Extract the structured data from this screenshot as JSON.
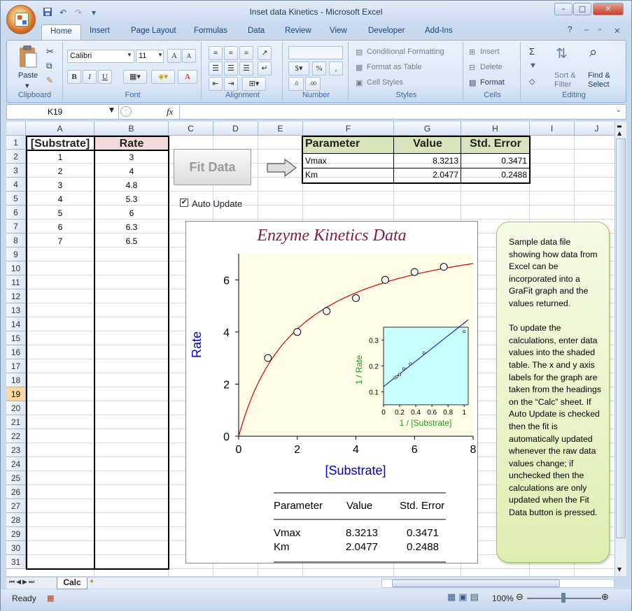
{
  "window": {
    "title": "Inset data Kinetics - Microsoft Excel",
    "controls": [
      "–",
      "□",
      "✕"
    ]
  },
  "qat": {
    "icons": [
      "save-icon",
      "undo-icon",
      "redo-icon",
      "customize-icon"
    ]
  },
  "tabs": [
    "Home",
    "Insert",
    "Page Layout",
    "Formulas",
    "Data",
    "Review",
    "View",
    "Developer",
    "Add-Ins"
  ],
  "ribbon": {
    "clipboard": {
      "label": "Clipboard",
      "paste": "Paste"
    },
    "font": {
      "label": "Font",
      "name": "Calibri",
      "size": "11",
      "grow": "A",
      "shrink": "A",
      "bold": "B",
      "italic": "I",
      "underline": "U",
      "color": "A"
    },
    "alignment": {
      "label": "Alignment"
    },
    "number": {
      "label": "Number",
      "percent": "%"
    },
    "styles": {
      "label": "Styles",
      "conditional": "Conditional Formatting",
      "table": "Format as Table",
      "cell": "Cell Styles"
    },
    "cells": {
      "label": "Cells",
      "insert": "Insert",
      "delete": "Delete",
      "format": "Format"
    },
    "editing": {
      "label": "Editing",
      "sum": "Σ",
      "sort": "Sort &",
      "filter": "Filter",
      "find": "Find &",
      "select": "Select"
    }
  },
  "formula_bar": {
    "name_box": "K19",
    "fx": "fx",
    "value": ""
  },
  "columns": [
    "A",
    "B",
    "C",
    "D",
    "E",
    "F",
    "G",
    "H",
    "I",
    "J"
  ],
  "rows": [
    "1",
    "2",
    "3",
    "4",
    "5",
    "6",
    "7",
    "8",
    "9",
    "10",
    "11",
    "12",
    "13",
    "14",
    "15",
    "16",
    "17",
    "18",
    "19",
    "20",
    "21",
    "22",
    "23",
    "24",
    "25",
    "26",
    "27",
    "28",
    "29",
    "30",
    "31"
  ],
  "selected_row": "19",
  "data_table": {
    "headers": [
      "[Substrate]",
      "Rate"
    ],
    "rows": [
      [
        "1",
        "3"
      ],
      [
        "2",
        "4"
      ],
      [
        "3",
        "4.8"
      ],
      [
        "4",
        "5.3"
      ],
      [
        "5",
        "6"
      ],
      [
        "6",
        "6.3"
      ],
      [
        "7",
        "6.5"
      ]
    ]
  },
  "results_table": {
    "headers": [
      "Parameter",
      "Value",
      "Std. Error"
    ],
    "rows": [
      [
        "Vmax",
        "8.3213",
        "0.3471"
      ],
      [
        "Km",
        "2.0477",
        "0.2488"
      ]
    ]
  },
  "fit_button": "Fit Data",
  "auto_update": {
    "label": "Auto Update",
    "checked": true
  },
  "note": "Sample data file showing how data from Excel can be incorporated into a GraFit graph and the values returned.\n\nTo update the calculations, enter data values into the shaded table. The x and y axis labels for the graph are taken from the headings on the “Calc” sheet. If Auto Update is checked then the fit is automatically updated whenever the raw data values change; if unchecked then the calculations are only updated when the Fit Data button is pressed.",
  "sheet_tabs": [
    "Calc"
  ],
  "status": {
    "ready": "Ready",
    "zoom": "100%"
  },
  "colors": {
    "title": "#8b1a4a",
    "axis_label": "#0000cc",
    "inset_label": "#1a9a1a",
    "fit_line": "#d40000",
    "plot_bg": "#fffde6",
    "inset_bg": "#c8ffff",
    "shaded": "#e8f0d8"
  },
  "chart_data": [
    {
      "type": "scatter",
      "title": "Enzyme Kinetics Data",
      "xlabel": "[Substrate]",
      "ylabel": "Rate",
      "xlim": [
        0,
        8
      ],
      "ylim": [
        0,
        7
      ],
      "xticks": [
        "0",
        "2",
        "4",
        "6",
        "8"
      ],
      "yticks": [
        "0",
        "2",
        "4",
        "6"
      ],
      "x": [
        1,
        2,
        3,
        4,
        5,
        6,
        7
      ],
      "y": [
        3,
        4,
        4.8,
        5.3,
        6,
        6.3,
        6.5
      ],
      "fit": {
        "model": "michaelis-menten",
        "vmax": 8.3213,
        "km": 2.0477
      },
      "legend": {
        "headers": [
          "Parameter",
          "Value",
          "Std. Error"
        ],
        "rows": [
          [
            "Vmax",
            "8.3213",
            "0.3471"
          ],
          [
            "Km",
            "2.0477",
            "0.2488"
          ]
        ]
      }
    },
    {
      "type": "scatter",
      "title": "",
      "xlabel": "1 / [Substrate]",
      "ylabel": "1 / Rate",
      "xlim": [
        0,
        1.05
      ],
      "ylim": [
        0.05,
        0.35
      ],
      "xticks": [
        "0",
        "0.2",
        "0.4",
        "0.6",
        "0.8",
        "1"
      ],
      "yticks": [
        "0.1",
        "0.2",
        "0.3"
      ],
      "x": [
        1,
        0.5,
        0.333,
        0.25,
        0.2,
        0.167,
        0.143
      ],
      "y": [
        0.333,
        0.25,
        0.208,
        0.189,
        0.167,
        0.159,
        0.154
      ]
    }
  ]
}
